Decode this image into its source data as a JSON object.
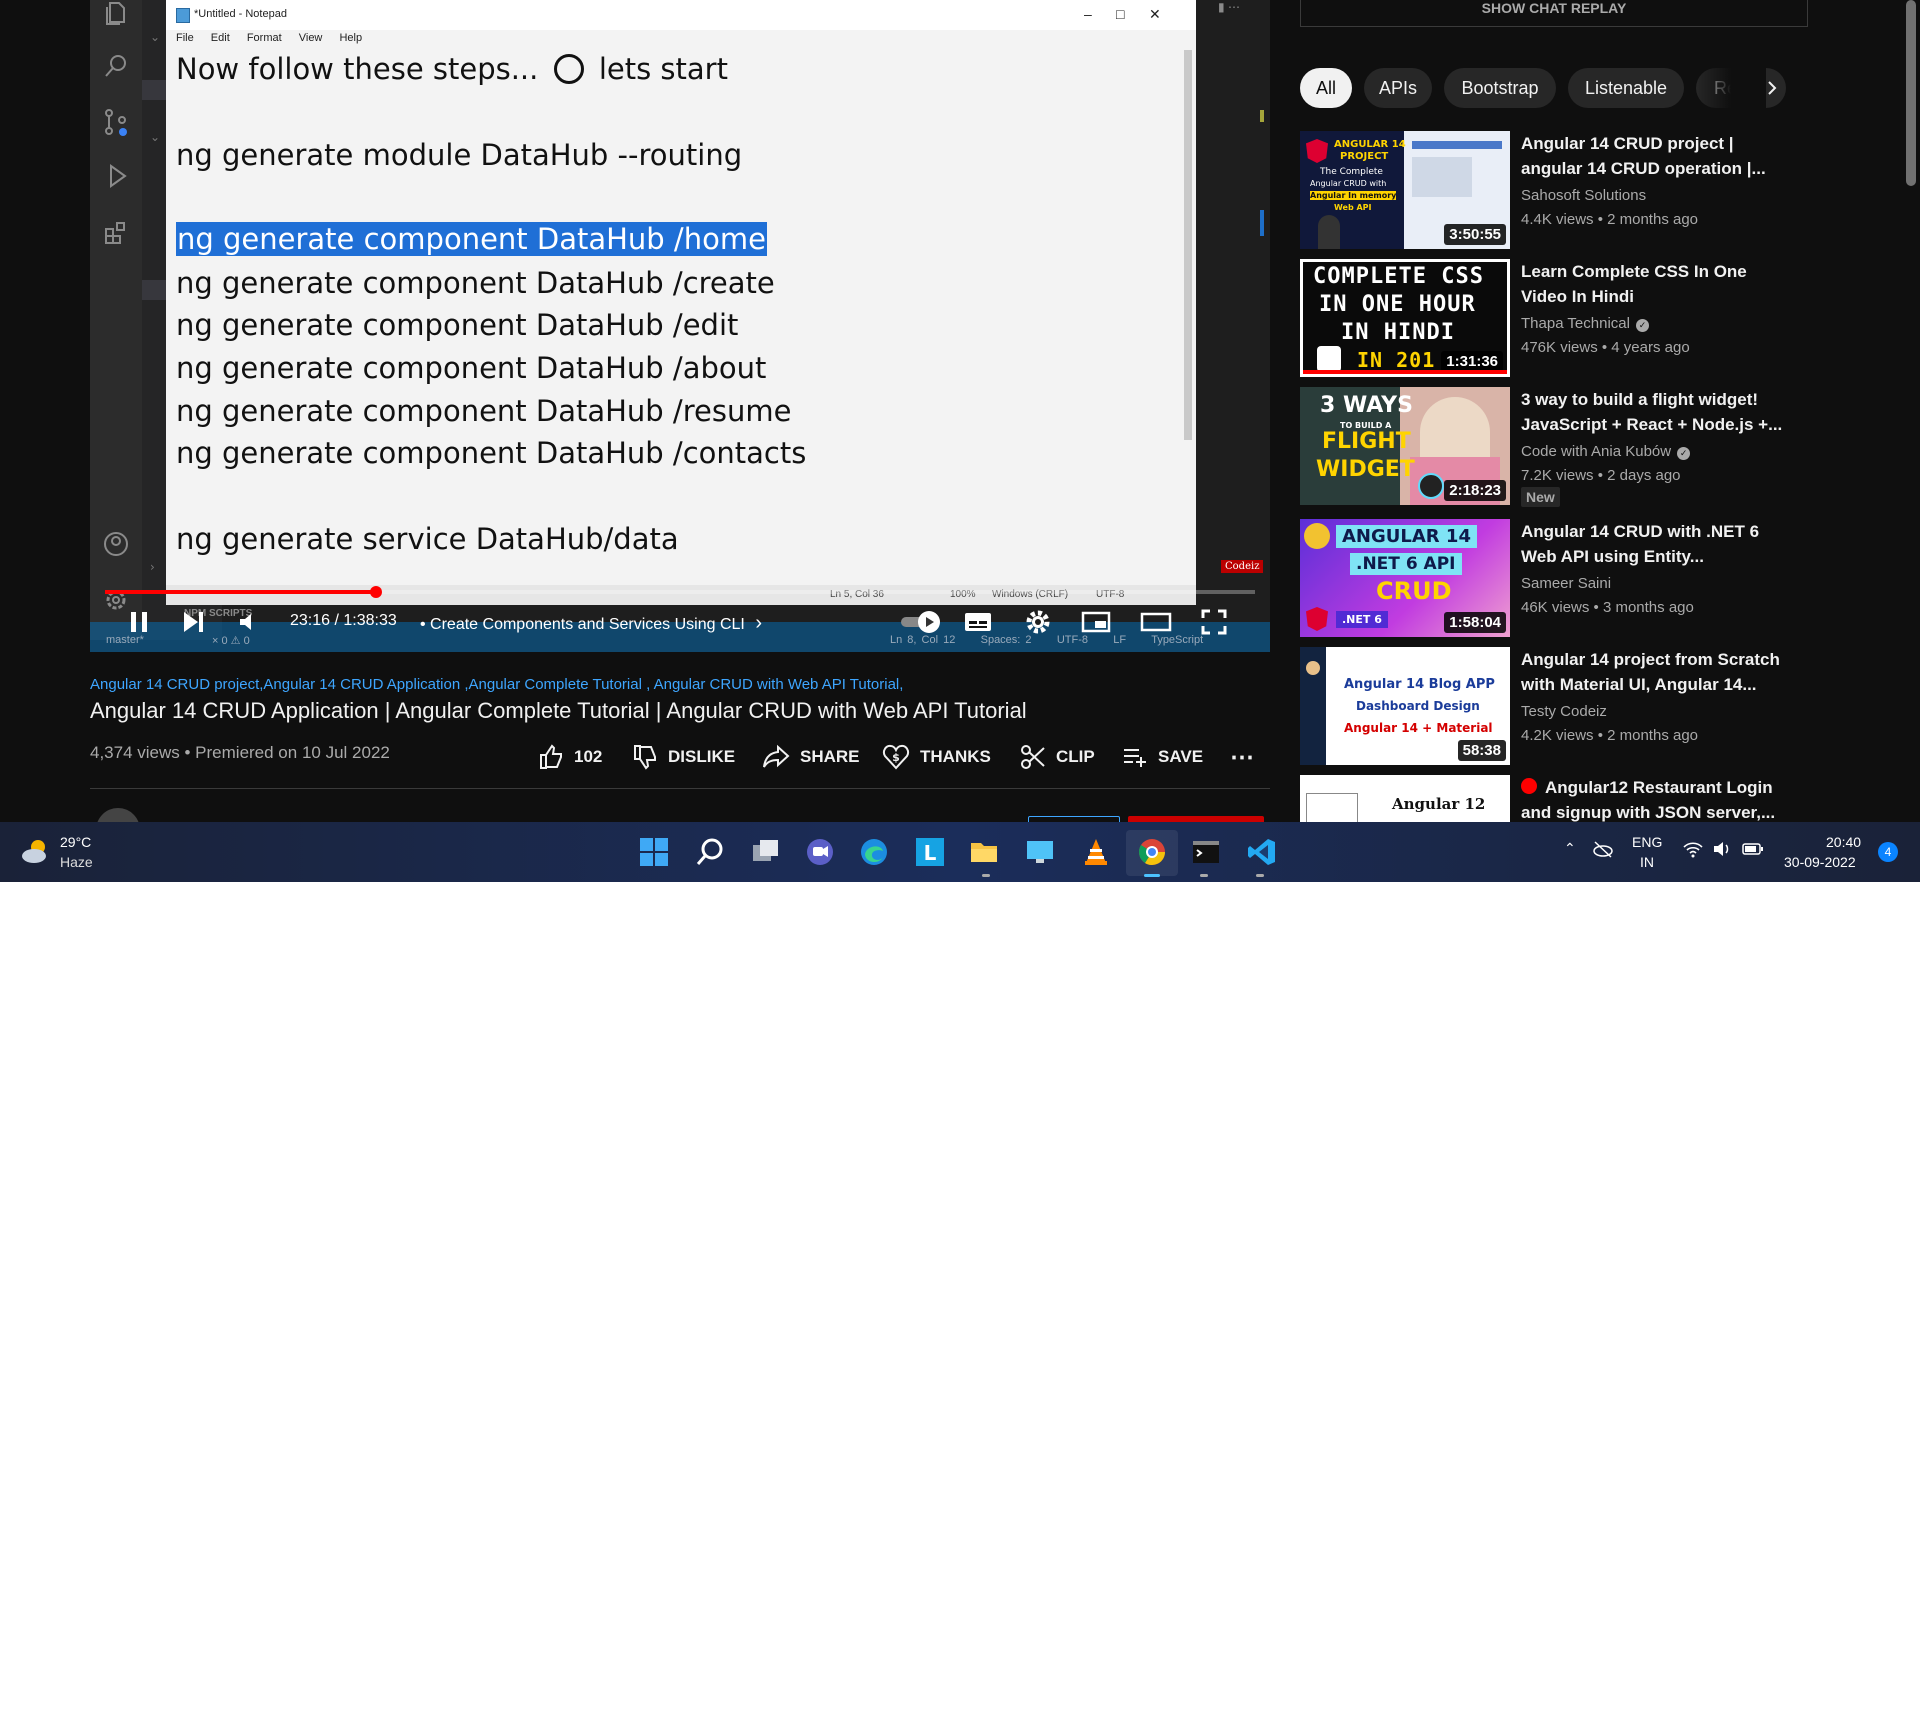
{
  "colors": {
    "accent_red": "#ff0000",
    "link_blue": "#3ea6ff",
    "page_bg": "#0f0f0f",
    "text_primary": "#f1f1f1",
    "text_secondary": "#aaaaaa"
  },
  "player": {
    "notepad": {
      "window_title": "*Untitled - Notepad",
      "menu": [
        "File",
        "Edit",
        "Format",
        "View",
        "Help"
      ],
      "lines": [
        "Now follow these steps...",
        "lets start",
        "ng generate module DataHub --routing",
        "ng generate component DataHub /home",
        "ng generate component DataHub /create",
        "ng generate component DataHub /edit",
        "ng generate component DataHub /about",
        "ng generate component DataHub /resume",
        "ng generate component DataHub /contacts",
        "ng generate service DataHub/data"
      ],
      "status": {
        "position": "Ln 5, Col 36",
        "zoom": "100%",
        "line_ending": "Windows (CRLF)",
        "encoding": "UTF-8"
      },
      "watermark": "Codeiz"
    },
    "vscode": {
      "npm_scripts_label": "NPM SCRIPTS",
      "branch": "master*",
      "problems": "× 0 ⚠ 0",
      "status_right": [
        "Ln 8, Col 12",
        "Spaces: 2",
        "UTF-8",
        "LF",
        "TypeScript"
      ]
    },
    "time_current": "23:16",
    "time_total": "1:38:33",
    "time_display": "23:16 / 1:38:33",
    "chapter": "•  Create Components and Services Using CLI",
    "progress_fraction": 0.236,
    "buffered_fraction": 0.23,
    "icons": [
      "pause-icon",
      "next-icon",
      "volume-icon",
      "autoplay-toggle-icon",
      "subtitles-icon",
      "settings-icon",
      "miniplayer-icon",
      "theater-icon",
      "fullscreen-icon"
    ]
  },
  "video": {
    "hashtags": "Angular 14 CRUD project,Angular 14 CRUD Application ,Angular Complete Tutorial , Angular CRUD with Web API Tutorial,",
    "title": "Angular 14 CRUD Application | Angular Complete Tutorial | Angular CRUD with Web API Tutorial",
    "views_line": "4,374 views • Premiered on 10 Jul 2022",
    "actions": {
      "like_count": "102",
      "dislike": "DISLIKE",
      "share": "SHARE",
      "thanks": "THANKS",
      "clip": "CLIP",
      "save": "SAVE"
    }
  },
  "sidebar": {
    "chat_replay": "SHOW CHAT REPLAY",
    "chips": [
      "All",
      "APIs",
      "Bootstrap",
      "Listenable",
      "Rela"
    ],
    "recommendations": [
      {
        "title": "Angular 14 CRUD project | angular 14 CRUD operation |...",
        "channel": "Sahosoft Solutions",
        "meta": "4.4K views • 2 months ago",
        "duration": "3:50:55",
        "thumb_text": [
          "ANGULAR 14",
          "PROJECT",
          "The Complete",
          "Angular CRUD with",
          "Angular In memory",
          "Web API"
        ]
      },
      {
        "title": "Learn Complete CSS In One Video In Hindi",
        "channel": "Thapa Technical",
        "verified": true,
        "meta": "476K views • 4 years ago",
        "duration": "1:31:36",
        "watched_fraction": 1.0,
        "thumb_text": [
          "COMPLETE CSS",
          "IN ONE HOUR",
          "IN HINDI",
          "IN 201"
        ]
      },
      {
        "title": "3 way to build a flight widget! JavaScript + React + Node.js +...",
        "channel": "Code with Ania Kubów",
        "verified": true,
        "meta": "7.2K views • 2 days ago",
        "badge": "New",
        "duration": "2:18:23",
        "thumb_text": [
          "3 WAYS",
          "TO BUILD A",
          "FLIGHT",
          "WIDGET"
        ]
      },
      {
        "title": "Angular 14 CRUD with .NET 6 Web API using Entity...",
        "channel": "Sameer Saini",
        "meta": "46K views • 3 months ago",
        "duration": "1:58:04",
        "thumb_text": [
          "ANGULAR 14",
          ".NET 6  API",
          "CRUD",
          ".NET 6"
        ]
      },
      {
        "title": "Angular 14 project from Scratch with Material UI, Angular 14...",
        "channel": "Testy Codeiz",
        "meta": "4.2K views • 2 months ago",
        "duration": "58:38",
        "thumb_text": [
          "Angular 14 Blog APP",
          "Dashboard Design",
          "Angular 14 + Material"
        ]
      },
      {
        "title": "Angular12 Restaurant Login and signup with JSON server,...",
        "live_dot": true,
        "thumb_text": [
          "Angular 12"
        ]
      }
    ]
  },
  "taskbar": {
    "weather_temp": "29°C",
    "weather_desc": "Haze",
    "apps": [
      "windows-start-icon",
      "search-icon",
      "task-view-icon",
      "teams-chat-icon",
      "edge-icon",
      "app-l-icon",
      "file-explorer-icon",
      "remote-desktop-icon",
      "vlc-icon",
      "chrome-icon",
      "terminal-icon",
      "vscode-icon"
    ],
    "lang": "ENG",
    "region": "IN",
    "time": "20:40",
    "date": "30-09-2022",
    "notification_count": "4"
  }
}
